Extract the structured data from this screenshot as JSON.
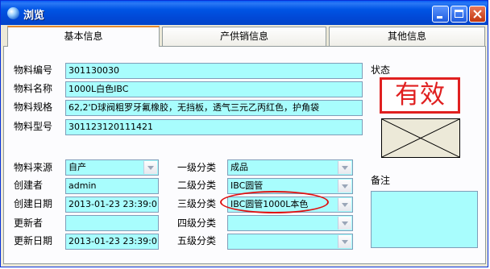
{
  "window": {
    "title": "浏览"
  },
  "tabs": [
    {
      "label": "基本信息",
      "active": true
    },
    {
      "label": "产供销信息",
      "active": false
    },
    {
      "label": "其他信息",
      "active": false
    }
  ],
  "basic": {
    "code_label": "物料编号",
    "code_value": "301130030",
    "name_label": "物料名称",
    "name_value": "1000L白色IBC",
    "spec_label": "物料规格",
    "spec_value": "62,2'D球阀粗罗牙氟橡胶，无挡板，透气三元乙丙红色，护角袋",
    "model_label": "物料型号",
    "model_value": "301123120111421"
  },
  "meta": {
    "source_label": "物料来源",
    "source_value": "自产",
    "creator_label": "创建者",
    "creator_value": "admin",
    "create_date_label": "创建日期",
    "create_date_value": "2013-01-23 23:39:0",
    "updater_label": "更新者",
    "updater_value": "",
    "update_date_label": "更新日期",
    "update_date_value": "2013-01-23 23:39:0"
  },
  "categories": {
    "level1_label": "一级分类",
    "level1_value": "成品",
    "level2_label": "二级分类",
    "level2_value": "IBC圆管",
    "level3_label": "三级分类",
    "level3_value": "IBC圆管1000L本色",
    "level4_label": "四级分类",
    "level4_value": "",
    "level5_label": "五级分类",
    "level5_value": ""
  },
  "status": {
    "label": "状态",
    "stamp": "有效",
    "stamp_color": "#e02020"
  },
  "remark": {
    "label": "备注",
    "value": ""
  },
  "colors": {
    "field_bg": "#a8fdfd",
    "title_bar": "#0055e5",
    "highlight": "#e01010"
  }
}
